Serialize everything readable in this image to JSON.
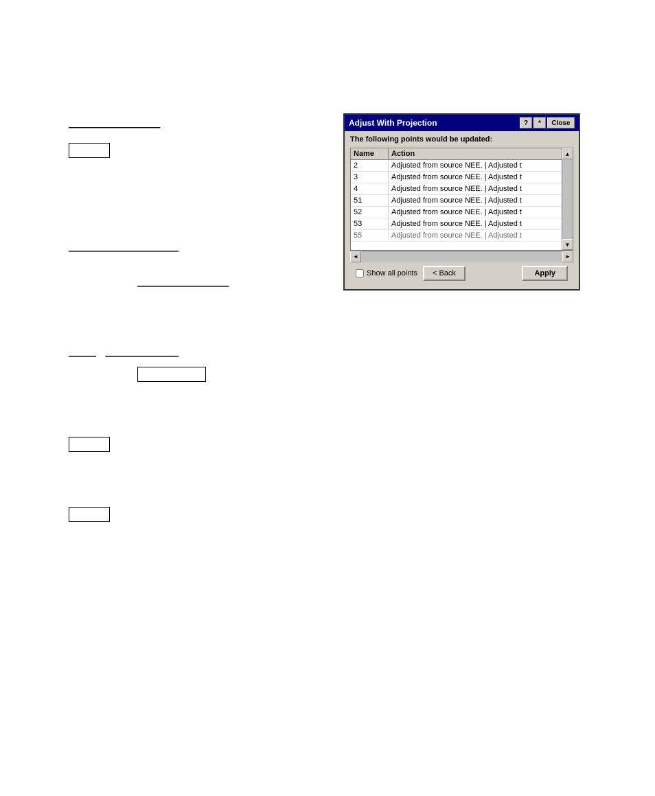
{
  "dialog": {
    "title": "Adjust With Projection",
    "help_button": "?",
    "pin_button": "*",
    "close_button": "Close",
    "message": "The following points would be updated:",
    "columns": {
      "name": "Name",
      "action": "Action"
    },
    "rows": [
      {
        "name": "2",
        "action": "Adjusted from source NEE.  | Adjusted t"
      },
      {
        "name": "3",
        "action": "Adjusted from source NEE.  | Adjusted t"
      },
      {
        "name": "4",
        "action": "Adjusted from source NEE.  | Adjusted t"
      },
      {
        "name": "51",
        "action": "Adjusted from source NEE.  | Adjusted t"
      },
      {
        "name": "52",
        "action": "Adjusted from source NEE.  | Adjusted t"
      },
      {
        "name": "53",
        "action": "Adjusted from source NEE.  | Adjusted t"
      },
      {
        "name": "55",
        "action": "Adjusted from source NEE.  | Adjusted t"
      }
    ],
    "show_all_label": "Show all points",
    "back_button": "< Back",
    "apply_button": "Apply"
  },
  "document": {
    "line1": "",
    "underline1": "____________________",
    "block1": "",
    "underline2": "________________________",
    "underline3": "____________________",
    "underline4": "______  ________________",
    "box_label1": "",
    "box_label2": "",
    "box_label3": ""
  }
}
